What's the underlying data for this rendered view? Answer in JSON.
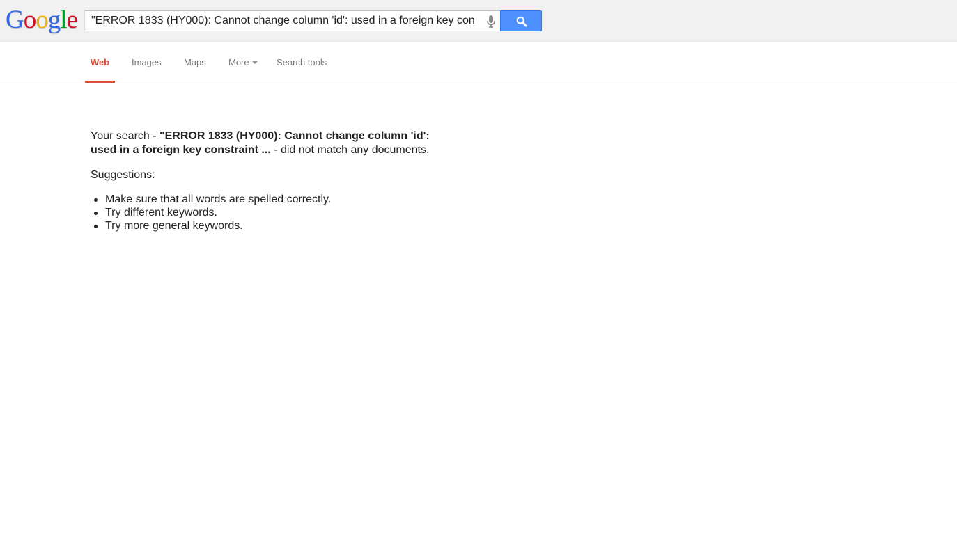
{
  "header": {
    "logo": {
      "letters": [
        "G",
        "o",
        "o",
        "g",
        "l",
        "e"
      ],
      "colors": [
        "#3369e8",
        "#d50f25",
        "#eeb211",
        "#3369e8",
        "#009925",
        "#d50f25"
      ]
    },
    "search": {
      "value": "\"ERROR 1833 (HY000): Cannot change column 'id': used in a foreign key con",
      "mic_icon": "microphone-icon",
      "button_icon": "search-icon"
    },
    "colors": {
      "bar_background": "#f1f1f1",
      "button_blue": "#4d90fe"
    }
  },
  "nav": {
    "tabs": [
      {
        "label": "Web",
        "active": true
      },
      {
        "label": "Images",
        "active": false
      },
      {
        "label": "Maps",
        "active": false
      },
      {
        "label": "More",
        "active": false,
        "dropdown": true
      },
      {
        "label": "Search tools",
        "active": false
      }
    ],
    "active_color": "#dd4b39"
  },
  "results": {
    "prefix": "Your search - ",
    "query": "\"ERROR 1833 (HY000): Cannot change column 'id': used in a foreign key constraint ...",
    "suffix": " - did not match any documents.",
    "suggestions_title": "Suggestions:",
    "suggestions": [
      "Make sure that all words are spelled correctly.",
      "Try different keywords.",
      "Try more general keywords."
    ]
  }
}
